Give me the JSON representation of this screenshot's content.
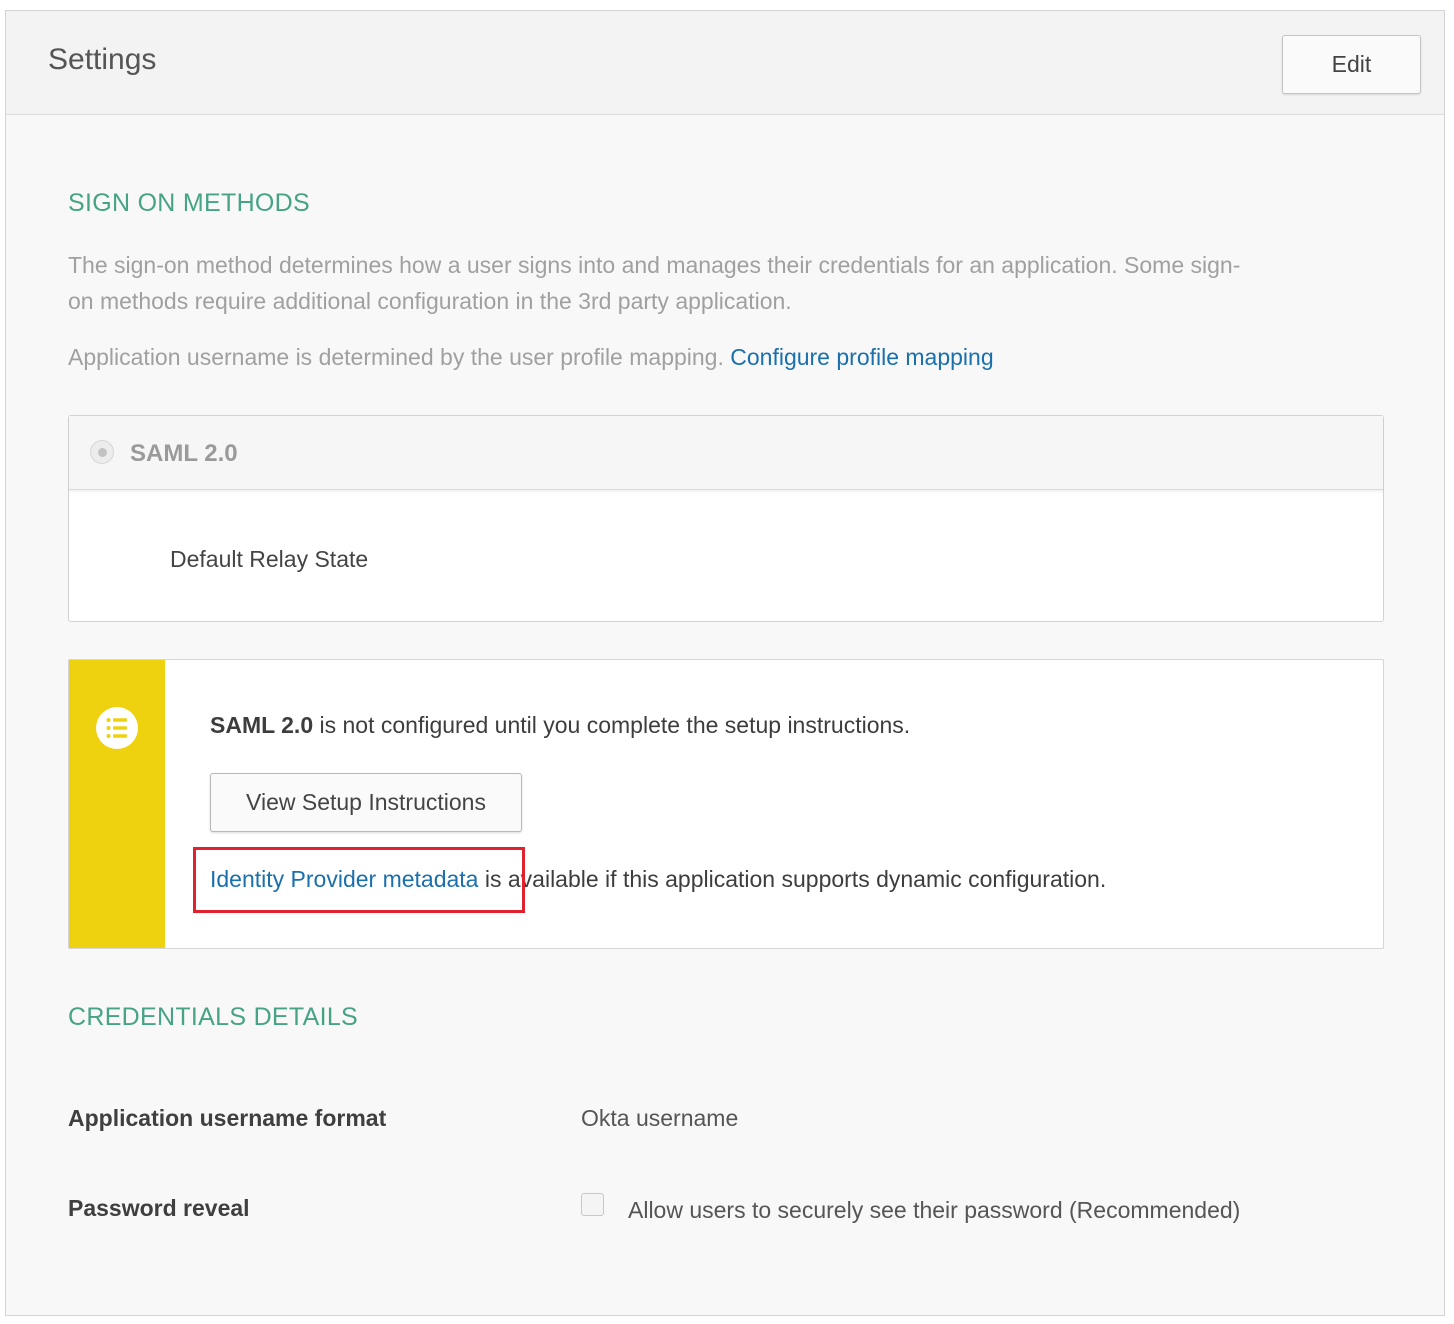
{
  "header": {
    "title": "Settings",
    "edit_label": "Edit"
  },
  "sign_on": {
    "section_title": "SIGN ON METHODS",
    "description_line1": "The sign-on method determines how a user signs into and manages their credentials for an application. Some sign-",
    "description_line2": "on methods require additional configuration in the 3rd party application.",
    "username_text": "Application username is determined by the user profile mapping.",
    "configure_link": "Configure profile mapping",
    "method_label": "SAML 2.0",
    "relay_state_label": "Default Relay State"
  },
  "notice": {
    "icon": "list-icon",
    "bold_text": "SAML 2.0",
    "text": " is not configured until you complete the setup instructions.",
    "setup_button": "View Setup Instructions",
    "metadata_link": "Identity Provider metadata",
    "metadata_text": " is available if this application supports dynamic configuration."
  },
  "credentials": {
    "section_title": "CREDENTIALS DETAILS",
    "username_format_label": "Application username format",
    "username_format_value": "Okta username",
    "password_reveal_label": "Password reveal",
    "password_reveal_option": "Allow users to securely see their password (Recommended)",
    "password_reveal_checked": false
  },
  "colors": {
    "section_title": "#46a386",
    "link": "#1a6fad",
    "notice_bar": "#efd20f",
    "highlight": "#e2212e"
  }
}
